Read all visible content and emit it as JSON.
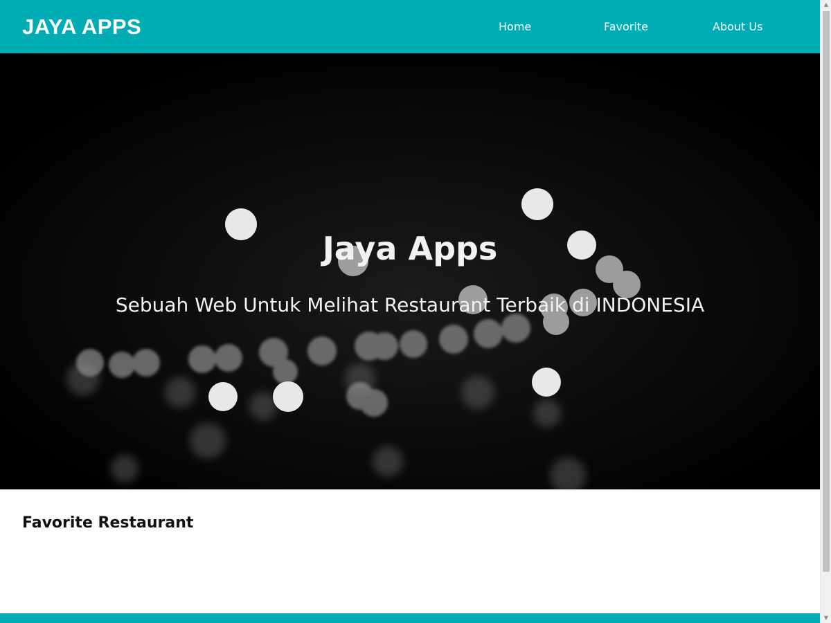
{
  "header": {
    "brand": "JAYA APPS",
    "nav": [
      {
        "label": "Home"
      },
      {
        "label": "Favorite"
      },
      {
        "label": "About Us"
      }
    ]
  },
  "hero": {
    "title": "Jaya Apps",
    "tagline": "Sebuah Web Untuk Melihat Restaurant Terbaik di INDONESIA"
  },
  "main": {
    "section_title": "Favorite Restaurant"
  },
  "colors": {
    "accent": "#00adb5",
    "hero_background": "#000000",
    "text_light": "#f2f2f2",
    "text_dark": "#111111"
  }
}
